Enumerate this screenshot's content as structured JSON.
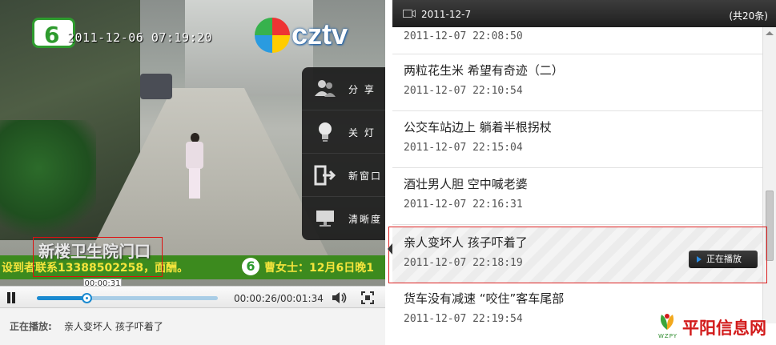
{
  "video": {
    "channel_logo": "6",
    "timestamp": "2011-12-06 07:19:20",
    "watermark_logo": "cztv",
    "caption_overlay": "新楼卫生院门口",
    "ticker_left": "设到者联系13388502258，面酬。",
    "ticker_badge": "6",
    "ticker_right": "曹女士：12月6日晚1"
  },
  "side_menu": {
    "items": [
      {
        "label": "分 享",
        "icon": "share-users-icon"
      },
      {
        "label": "关 灯",
        "icon": "lightbulb-icon"
      },
      {
        "label": "新窗口",
        "icon": "new-window-icon"
      },
      {
        "label": "清晰度",
        "icon": "clarity-monitor-icon"
      }
    ]
  },
  "controls": {
    "hover_time": "00:00:31",
    "time_readout": "00:00:26/00:01:34",
    "progress_fraction": 0.276
  },
  "now_playing": {
    "label": "正在播放:",
    "title": "亲人变坏人 孩子吓着了"
  },
  "playlist": {
    "header_date": "2011-12-7",
    "total": "(共20条)",
    "items": [
      {
        "title": "",
        "time": "2011-12-07 22:08:50"
      },
      {
        "title": "两粒花生米 希望有奇迹（二）",
        "time": "2011-12-07 22:10:54"
      },
      {
        "title": "公交车站边上 躺着半根拐杖",
        "time": "2011-12-07 22:15:04"
      },
      {
        "title": "酒壮男人胆 空中喊老婆",
        "time": "2011-12-07 22:16:31"
      },
      {
        "title": "亲人变坏人 孩子吓着了",
        "time": "2011-12-07 22:18:19",
        "active": true
      },
      {
        "title": "货车没有减速 “咬住”客车尾部",
        "time": "2011-12-07 22:19:54"
      }
    ],
    "playing_label": "正在播放"
  },
  "brand": {
    "name": "平阳信息网",
    "sub": "WZPY"
  },
  "colors": {
    "accent_blue": "#1b8ad0",
    "highlight_red": "#d22222",
    "ticker_green": "#3c8a1e",
    "ticker_yellow": "#f5e53c"
  }
}
